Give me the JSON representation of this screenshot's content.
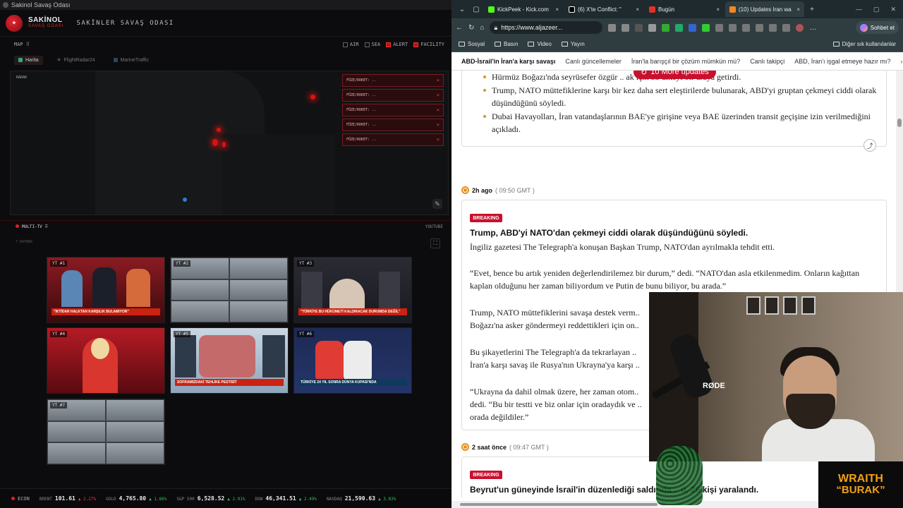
{
  "left_app": {
    "window_title": "Sakinol Savaş Odası",
    "brand_name": "SAKİNOL",
    "brand_sub": "SAVAŞ ODASI",
    "app_title": "SAKİNLER SAVAŞ ODASI",
    "map_label": "MAP ⠿",
    "filters": [
      {
        "label": "AIR",
        "checked": false
      },
      {
        "label": "SEA",
        "checked": false
      },
      {
        "label": "ALERT",
        "checked": true
      },
      {
        "label": "FACILITY",
        "checked": true
      }
    ],
    "tabs": [
      "Harita",
      "FlightRadar24",
      "MarineTraffic"
    ],
    "radar_label": "RADAR",
    "alerts": [
      "FÜZE/ROKET: ..",
      "FÜZE/ROKET: ..",
      "FÜZE/ROKET: ..",
      "FÜZE/ROKET: ..",
      "FÜZE/ROKET: .."
    ],
    "multitv_label": "MULTI-TV ⠿",
    "youtube_label": "YOUTUBE",
    "sources_label": "7 KAYNAK",
    "tiles": [
      {
        "label": "YT #1",
        "caption": "\"İKTİDAR HALKTAN KARŞILIK BULAMIYOR\""
      },
      {
        "label": "YT #2",
        "caption": ""
      },
      {
        "label": "YT #3",
        "caption": "\"TÜRKİYE BU HÜKÜMETİ KALDIRACAK DURUMDA DEĞİL\""
      },
      {
        "label": "YT #4",
        "caption": ""
      },
      {
        "label": "YT #5",
        "caption": "SOFRAMIZDAKİ TEHLİKE PESTİSİT"
      },
      {
        "label": "YT #6",
        "caption": "TÜRKİYE 24 YIL SONRA DÜNYA KUPASI'NDA"
      },
      {
        "label": "YT #7",
        "caption": ""
      }
    ],
    "econ": {
      "label": "ECON",
      "tickers": [
        {
          "name": "BRENT",
          "value": "101.61",
          "change": "▲ 2.27%"
        },
        {
          "name": "GOLD",
          "value": "4,765.80",
          "change": "▲ 1.86%"
        },
        {
          "name": "S&P 500",
          "value": "6,528.52",
          "change": "▲ 2.91%"
        },
        {
          "name": "DOW",
          "value": "46,341.51",
          "change": "▲ 2.49%"
        },
        {
          "name": "NASDAQ",
          "value": "21,590.63",
          "change": "▲ 3.83%"
        }
      ]
    }
  },
  "browser": {
    "tabs": [
      {
        "title": "KickPeek - Kick.com",
        "color": "#53fc18"
      },
      {
        "title": "(6) X'te Conflict: \"",
        "color": "#ffffff"
      },
      {
        "title": "Bugün",
        "color": "#e0312b"
      },
      {
        "title": "(10) Updates Iran wa",
        "color": "#f08a24"
      }
    ],
    "url": "https://www.aljazeer...",
    "copilot_label": "Sohbet et",
    "favorites": [
      "Sosyal",
      "Basın",
      "Video",
      "Yayın"
    ],
    "favorites_other": "Diğer sık kullanılanlar",
    "nav_strip": [
      "ABD-İsrail'in İran'a karşı savaşı",
      "Canlı güncellemeler",
      "İran'la barışçıl bir çözüm mümkün mü?",
      "Canlı takipçi",
      "ABD, İran'ı işgal etmeye hazır mı?"
    ],
    "more_updates": "10 More updates",
    "card1_bullets": [
      "Hürmüz Boğazı'nda seyrüsefer özgür .. ak için 35 ülkeyi bir araya getirdi.",
      "Trump, NATO müttefiklerine karşı bir kez daha sert eleştirilerde bulunarak, ABD'yi gruptan çekmeyi ciddi olarak düşündüğünü söyledi.",
      "Dubai Havayolları, İran vatandaşlarının BAE'ye girişine veya BAE üzerinden transit geçişine izin verilmediğini açıkladı."
    ],
    "post1": {
      "time": "2h ago",
      "gmt": "( 09:50 GMT )",
      "badge": "BREAKING",
      "headline": "Trump, ABD'yi NATO'dan çekmeyi ciddi olarak düşündüğünü söyledi.",
      "p1": "İngiliz gazetesi The Telegraph'a konuşan Başkan Trump, NATO'dan ayrılmakla tehdit etti.",
      "p2": "“Evet, bence bu artık yeniden değerlendirilemez bir durum,” dedi. “NATO'dan asla etkilenmedim. Onların kağıttan kaplan olduğunu her zaman biliyordum ve Putin de bunu biliyor, bu arada.”",
      "p3": "Trump, NATO müttefiklerini savaşa destek verm.. Boğazı'na asker göndermeyi reddettikleri için on..",
      "p4": "Bu şikayetlerini The Telegraph'a da tekrarlayan .. İran'a karşı savaş ile Rusya'nın Ukrayna'ya karşı ..",
      "p5": "“Ukrayna da dahil olmak üzere, her zaman otom.. dedi. “Bu bir testti ve biz onlar için oradaydık ve .. orada değildiler.”"
    },
    "post2": {
      "time": "2 saat önce",
      "gmt": "( 09:47 GMT )",
      "badge": "BREAKING",
      "headline": "Beyrut'un güneyinde İsrail'in düzenlediği saldırıda .. ü, 26 kişi yaralandı."
    }
  },
  "overlay": {
    "mic_brand": "RØDE",
    "streamer_line1": "WRAITH",
    "streamer_line2": "“BURAK”"
  }
}
